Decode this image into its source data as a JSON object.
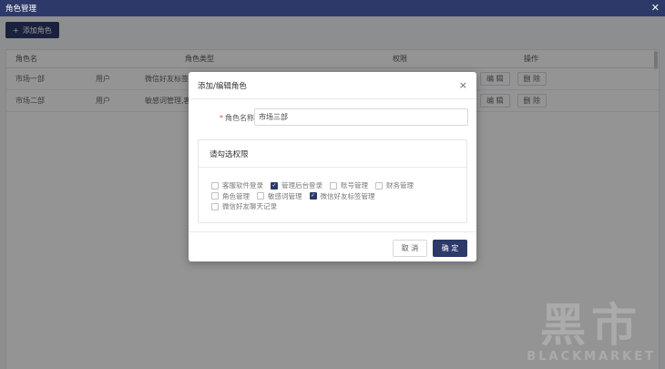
{
  "window": {
    "title": "角色管理",
    "close_glyph": "✕"
  },
  "toolbar": {
    "add_icon": "+",
    "add_label": "添加角色"
  },
  "table": {
    "headers": [
      "角色名",
      "角色类型",
      "权限",
      "操作"
    ],
    "rows": [
      {
        "name": "市场一部",
        "type": "用户",
        "perm": "微信好友标签管",
        "edit": "编 辑",
        "delete": "删 除"
      },
      {
        "name": "市场二部",
        "type": "用户",
        "perm": "敏感词管理,客户",
        "edit": "编 辑",
        "delete": "删 除"
      }
    ]
  },
  "modal": {
    "title": "添加/编辑角色",
    "close_glyph": "×",
    "name_label": "角色名称:",
    "name_value": "市场三部",
    "perm_title": "请勾选权限",
    "permissions": [
      {
        "label": "客服软件登录",
        "checked": false
      },
      {
        "label": "管理后台登录",
        "checked": true
      },
      {
        "label": "账号管理",
        "checked": false
      },
      {
        "label": "财务管理",
        "checked": false
      },
      {
        "label": "角色管理",
        "checked": false
      },
      {
        "label": "敏感词管理",
        "checked": false
      },
      {
        "label": "微信好友标签管理",
        "checked": true
      },
      {
        "label": "微信好友聊天记录",
        "checked": false
      }
    ],
    "cancel_label": "取 消",
    "ok_label": "确 定"
  },
  "watermark": {
    "big": "黑市",
    "small": "BLACKMARKET"
  },
  "colors": {
    "primary": "#2d3968",
    "required": "#e04a3f"
  }
}
